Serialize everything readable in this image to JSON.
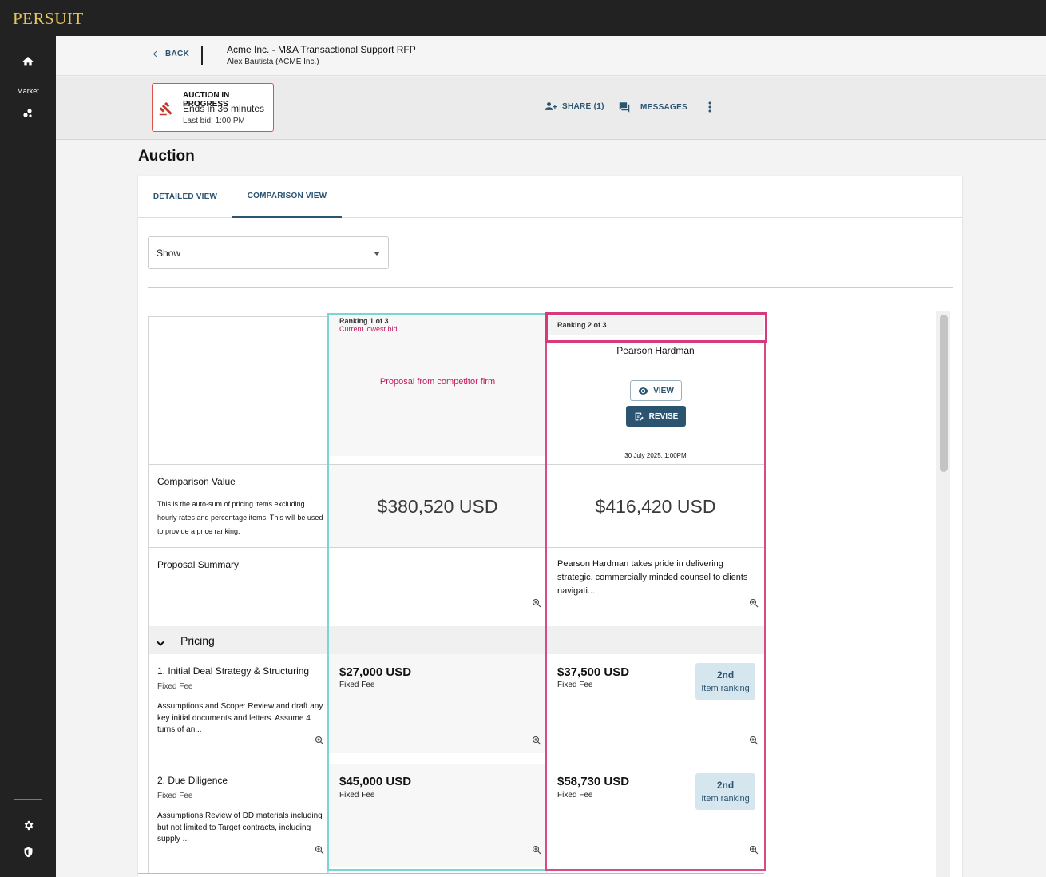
{
  "app": {
    "logo": "PERSUIT"
  },
  "rail": {
    "market_label": "Market"
  },
  "header": {
    "back_label": "BACK",
    "rfp_title": "Acme Inc. - M&A Transactional Support RFP",
    "rfp_subtitle": "Alex Bautista (ACME Inc.)"
  },
  "auction_status": {
    "title": "AUCTION IN PROGRESS",
    "ends": "Ends in 36 minutes",
    "last_bid": "Last bid: 1:00 PM"
  },
  "actions": {
    "share": "SHARE (1)",
    "messages": "MESSAGES"
  },
  "page_title": "Auction",
  "tabs": [
    {
      "label": "DETAILED VIEW",
      "active": false
    },
    {
      "label": "COMPARISON VIEW",
      "active": true
    }
  ],
  "filter": {
    "value": "Show"
  },
  "columns": [
    {
      "ranking": "Ranking 1 of 3",
      "ranking_note": "Current lowest bid",
      "placeholder": "Proposal from competitor firm",
      "comparison_value": "$380,520 USD",
      "summary": "",
      "items": [
        {
          "price": "$27,000 USD",
          "fee_type": "Fixed Fee"
        },
        {
          "price": "$45,000 USD",
          "fee_type": "Fixed Fee"
        }
      ]
    },
    {
      "ranking": "Ranking 2 of 3",
      "firm": "Pearson Hardman",
      "view_label": "VIEW",
      "revise_label": "REVISE",
      "date": "30 July 2025, 1:00PM",
      "comparison_value": "$416,420 USD",
      "summary": "Pearson Hardman takes pride in delivering strategic, commercially minded counsel to clients navigati...",
      "items": [
        {
          "price": "$37,500 USD",
          "fee_type": "Fixed Fee",
          "rank": "2nd",
          "rank_label": "Item ranking"
        },
        {
          "price": "$58,730 USD",
          "fee_type": "Fixed Fee",
          "rank": "2nd",
          "rank_label": "Item ranking"
        }
      ]
    }
  ],
  "rows": {
    "comparison_label": "Comparison Value",
    "comparison_desc": "This is the auto-sum of pricing items excluding hourly rates and percentage items. This will be used to provide a price ranking.",
    "summary_label": "Proposal Summary",
    "pricing_section": "Pricing",
    "items": [
      {
        "name": "1. Initial Deal Strategy & Structuring",
        "fee_type": "Fixed Fee",
        "desc": "Assumptions and Scope: Review and draft any key initial documents and letters. Assume 4 turns of an..."
      },
      {
        "name": "2. Due Diligence",
        "fee_type": "Fixed Fee",
        "desc": "Assumptions Review of DD materials including but not limited to Target contracts, including supply ..."
      }
    ]
  },
  "colors": {
    "brand": "#e6c35c",
    "accent": "#2b5470",
    "rank1": "#7ad6d2",
    "rank2": "#d94b86",
    "alert": "#d9534f"
  }
}
